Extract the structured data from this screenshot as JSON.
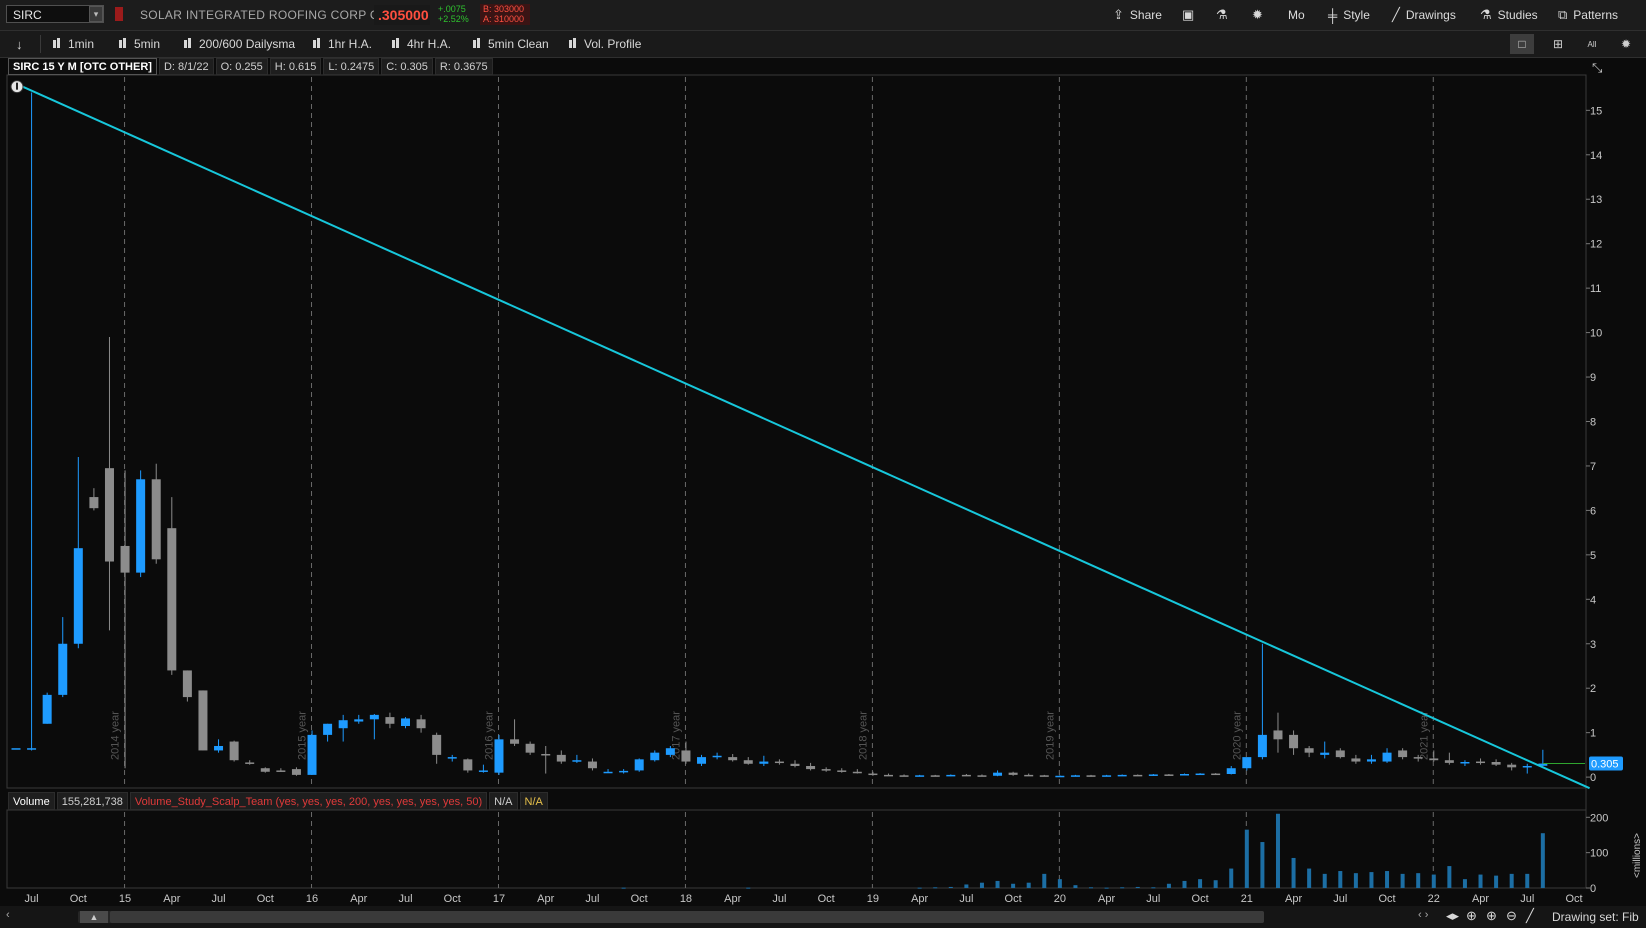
{
  "header": {
    "symbol": "SIRC",
    "dropdown_glyph": "▾",
    "company": "SOLAR INTEGRATED ROOFING CORP COM",
    "last_price": ".305000",
    "change_abs": "+.0075",
    "change_pct": "+2.52%",
    "bid": "B: 303000",
    "ask": "A: 310000",
    "buttons": {
      "share": "Share",
      "mo": "Mo",
      "style": "Style",
      "drawings": "Drawings",
      "studies": "Studies",
      "patterns": "Patterns"
    }
  },
  "toolbar": {
    "presets": [
      "1min",
      "5min",
      "200/600 Dailysma",
      "1hr H.A.",
      "4hr H.A.",
      "5min Clean",
      "Vol. Profile"
    ],
    "layout_all": "All"
  },
  "info_bar": {
    "title": "SIRC 15 Y M [OTC OTHER]",
    "date": "D: 8/1/22",
    "open": "O: 0.255",
    "high": "H: 0.615",
    "low": "L: 0.2475",
    "close": "C: 0.305",
    "range": "R: 0.3675"
  },
  "volume_bar": {
    "label": "Volume",
    "value": "155,281,738",
    "study": "Volume_Study_Scalp_Team (yes, yes, yes, 200, yes, yes, yes, yes, 50)",
    "na1": "N/A",
    "na2": "N/A"
  },
  "footer": {
    "drawing_set": "Drawing set: Fib"
  },
  "colors": {
    "up": "#1e9bff",
    "down": "#8c8c8c",
    "trendline": "#17c7db",
    "volume": "#1c6ea4",
    "price_label_bg": "#1e9bff",
    "grid": "#6a6a6a"
  },
  "chart_data": [
    {
      "type": "candlestick",
      "title": "SIRC 15 Y M [OTC OTHER]",
      "interval": "monthly",
      "ylim": [
        -0.2,
        15.75
      ],
      "y_ticks": [
        0,
        1,
        2,
        3,
        4,
        5,
        6,
        7,
        8,
        9,
        10,
        11,
        12,
        13,
        14,
        15
      ],
      "current_price_label": "0.305",
      "x_tick_labels": [
        "Jul",
        "Oct",
        "15",
        "Apr",
        "Jul",
        "Oct",
        "16",
        "Apr",
        "Jul",
        "Oct",
        "17",
        "Apr",
        "Jul",
        "Oct",
        "18",
        "Apr",
        "Jul",
        "Oct",
        "19",
        "Apr",
        "Jul",
        "Oct",
        "20",
        "Apr",
        "Jul",
        "Oct",
        "21",
        "Apr",
        "Jul",
        "Oct",
        "22",
        "Apr",
        "Jul",
        "Oct"
      ],
      "period_markers": [
        "2014 year",
        "2015 year",
        "2016 year",
        "2017 year",
        "2018 year",
        "2019 year",
        "2020 year",
        "2021 year"
      ],
      "candles": [
        {
          "d": "2014-06",
          "o": 0.65,
          "h": 0.65,
          "l": 0.65,
          "c": 0.65
        },
        {
          "d": "2014-07",
          "o": 0.65,
          "h": 15.4,
          "l": 0.6,
          "c": 0.65
        },
        {
          "d": "2014-08",
          "o": 1.2,
          "h": 1.9,
          "l": 1.2,
          "c": 1.85
        },
        {
          "d": "2014-09",
          "o": 1.85,
          "h": 3.6,
          "l": 1.8,
          "c": 3.0
        },
        {
          "d": "2014-10",
          "o": 3.0,
          "h": 7.2,
          "l": 2.9,
          "c": 5.15
        },
        {
          "d": "2014-11",
          "o": 6.3,
          "h": 6.5,
          "l": 6.0,
          "c": 6.05
        },
        {
          "d": "2014-12",
          "o": 6.95,
          "h": 9.9,
          "l": 3.3,
          "c": 4.85
        },
        {
          "d": "2015-01",
          "o": 5.2,
          "h": 6.9,
          "l": 0.2,
          "c": 4.6
        },
        {
          "d": "2015-02",
          "o": 4.6,
          "h": 6.9,
          "l": 4.5,
          "c": 6.7
        },
        {
          "d": "2015-03",
          "o": 6.7,
          "h": 7.05,
          "l": 4.8,
          "c": 4.9
        },
        {
          "d": "2015-04",
          "o": 5.6,
          "h": 6.3,
          "l": 2.3,
          "c": 2.4
        },
        {
          "d": "2015-05",
          "o": 2.4,
          "h": 2.4,
          "l": 1.7,
          "c": 1.8
        },
        {
          "d": "2015-06",
          "o": 1.95,
          "h": 1.95,
          "l": 0.6,
          "c": 0.6
        },
        {
          "d": "2015-07",
          "o": 0.6,
          "h": 0.85,
          "l": 0.55,
          "c": 0.7
        },
        {
          "d": "2015-08",
          "o": 0.8,
          "h": 0.82,
          "l": 0.35,
          "c": 0.38
        },
        {
          "d": "2015-09",
          "o": 0.33,
          "h": 0.38,
          "l": 0.28,
          "c": 0.3
        },
        {
          "d": "2015-10",
          "o": 0.2,
          "h": 0.22,
          "l": 0.1,
          "c": 0.12
        },
        {
          "d": "2015-11",
          "o": 0.15,
          "h": 0.2,
          "l": 0.12,
          "c": 0.14
        },
        {
          "d": "2015-12",
          "o": 0.18,
          "h": 0.22,
          "l": 0.03,
          "c": 0.05
        },
        {
          "d": "2016-01",
          "o": 0.05,
          "h": 1.05,
          "l": 0.05,
          "c": 0.95
        },
        {
          "d": "2016-02",
          "o": 0.95,
          "h": 1.2,
          "l": 0.8,
          "c": 1.2
        },
        {
          "d": "2016-03",
          "o": 1.1,
          "h": 1.4,
          "l": 0.8,
          "c": 1.28
        },
        {
          "d": "2016-04",
          "o": 1.25,
          "h": 1.4,
          "l": 1.2,
          "c": 1.3
        },
        {
          "d": "2016-05",
          "o": 1.3,
          "h": 1.42,
          "l": 0.85,
          "c": 1.4
        },
        {
          "d": "2016-06",
          "o": 1.35,
          "h": 1.45,
          "l": 1.1,
          "c": 1.2
        },
        {
          "d": "2016-07",
          "o": 1.15,
          "h": 1.35,
          "l": 1.1,
          "c": 1.32
        },
        {
          "d": "2016-08",
          "o": 1.3,
          "h": 1.4,
          "l": 1.0,
          "c": 1.1
        },
        {
          "d": "2016-09",
          "o": 0.95,
          "h": 1.0,
          "l": 0.3,
          "c": 0.5
        },
        {
          "d": "2016-10",
          "o": 0.45,
          "h": 0.5,
          "l": 0.35,
          "c": 0.45
        },
        {
          "d": "2016-11",
          "o": 0.4,
          "h": 0.42,
          "l": 0.1,
          "c": 0.15
        },
        {
          "d": "2016-12",
          "o": 0.15,
          "h": 0.28,
          "l": 0.1,
          "c": 0.15
        },
        {
          "d": "2017-01",
          "o": 0.1,
          "h": 0.95,
          "l": 0.05,
          "c": 0.85
        },
        {
          "d": "2017-02",
          "o": 0.85,
          "h": 1.3,
          "l": 0.7,
          "c": 0.75
        },
        {
          "d": "2017-03",
          "o": 0.75,
          "h": 0.8,
          "l": 0.5,
          "c": 0.55
        },
        {
          "d": "2017-04",
          "o": 0.52,
          "h": 0.7,
          "l": 0.08,
          "c": 0.5
        },
        {
          "d": "2017-05",
          "o": 0.5,
          "h": 0.6,
          "l": 0.3,
          "c": 0.35
        },
        {
          "d": "2017-06",
          "o": 0.35,
          "h": 0.5,
          "l": 0.32,
          "c": 0.38
        },
        {
          "d": "2017-07",
          "o": 0.35,
          "h": 0.42,
          "l": 0.15,
          "c": 0.2
        },
        {
          "d": "2017-08",
          "o": 0.12,
          "h": 0.18,
          "l": 0.1,
          "c": 0.12
        },
        {
          "d": "2017-09",
          "o": 0.12,
          "h": 0.18,
          "l": 0.08,
          "c": 0.14
        },
        {
          "d": "2017-10",
          "o": 0.15,
          "h": 0.42,
          "l": 0.12,
          "c": 0.4
        },
        {
          "d": "2017-11",
          "o": 0.38,
          "h": 0.6,
          "l": 0.35,
          "c": 0.55
        },
        {
          "d": "2017-12",
          "o": 0.5,
          "h": 0.7,
          "l": 0.45,
          "c": 0.65
        },
        {
          "d": "2018-01",
          "o": 0.6,
          "h": 0.8,
          "l": 0.3,
          "c": 0.35
        },
        {
          "d": "2018-02",
          "o": 0.3,
          "h": 0.5,
          "l": 0.25,
          "c": 0.45
        },
        {
          "d": "2018-03",
          "o": 0.45,
          "h": 0.55,
          "l": 0.4,
          "c": 0.48
        },
        {
          "d": "2018-04",
          "o": 0.45,
          "h": 0.52,
          "l": 0.35,
          "c": 0.38
        },
        {
          "d": "2018-05",
          "o": 0.38,
          "h": 0.45,
          "l": 0.28,
          "c": 0.3
        },
        {
          "d": "2018-06",
          "o": 0.3,
          "h": 0.48,
          "l": 0.25,
          "c": 0.35
        },
        {
          "d": "2018-07",
          "o": 0.35,
          "h": 0.4,
          "l": 0.28,
          "c": 0.32
        },
        {
          "d": "2018-08",
          "o": 0.3,
          "h": 0.38,
          "l": 0.22,
          "c": 0.25
        },
        {
          "d": "2018-09",
          "o": 0.25,
          "h": 0.32,
          "l": 0.15,
          "c": 0.18
        },
        {
          "d": "2018-10",
          "o": 0.18,
          "h": 0.22,
          "l": 0.12,
          "c": 0.15
        },
        {
          "d": "2018-11",
          "o": 0.15,
          "h": 0.2,
          "l": 0.1,
          "c": 0.12
        },
        {
          "d": "2018-12",
          "o": 0.12,
          "h": 0.18,
          "l": 0.08,
          "c": 0.1
        },
        {
          "d": "2019-01",
          "o": 0.08,
          "h": 0.12,
          "l": 0.03,
          "c": 0.05
        },
        {
          "d": "2019-02",
          "o": 0.05,
          "h": 0.08,
          "l": 0.03,
          "c": 0.04
        },
        {
          "d": "2019-03",
          "o": 0.04,
          "h": 0.06,
          "l": 0.02,
          "c": 0.03
        },
        {
          "d": "2019-04",
          "o": 0.03,
          "h": 0.05,
          "l": 0.02,
          "c": 0.04
        },
        {
          "d": "2019-05",
          "o": 0.04,
          "h": 0.05,
          "l": 0.02,
          "c": 0.03
        },
        {
          "d": "2019-06",
          "o": 0.03,
          "h": 0.06,
          "l": 0.02,
          "c": 0.05
        },
        {
          "d": "2019-07",
          "o": 0.05,
          "h": 0.07,
          "l": 0.03,
          "c": 0.04
        },
        {
          "d": "2019-08",
          "o": 0.04,
          "h": 0.06,
          "l": 0.02,
          "c": 0.03
        },
        {
          "d": "2019-09",
          "o": 0.03,
          "h": 0.15,
          "l": 0.02,
          "c": 0.1
        },
        {
          "d": "2019-10",
          "o": 0.1,
          "h": 0.12,
          "l": 0.03,
          "c": 0.05
        },
        {
          "d": "2019-11",
          "o": 0.05,
          "h": 0.08,
          "l": 0.03,
          "c": 0.04
        },
        {
          "d": "2019-12",
          "o": 0.04,
          "h": 0.05,
          "l": 0.02,
          "c": 0.03
        },
        {
          "d": "2020-01",
          "o": 0.02,
          "h": 0.04,
          "l": 0.01,
          "c": 0.03
        },
        {
          "d": "2020-02",
          "o": 0.03,
          "h": 0.05,
          "l": 0.02,
          "c": 0.04
        },
        {
          "d": "2020-03",
          "o": 0.04,
          "h": 0.05,
          "l": 0.01,
          "c": 0.02
        },
        {
          "d": "2020-04",
          "o": 0.02,
          "h": 0.05,
          "l": 0.02,
          "c": 0.04
        },
        {
          "d": "2020-05",
          "o": 0.04,
          "h": 0.06,
          "l": 0.03,
          "c": 0.05
        },
        {
          "d": "2020-06",
          "o": 0.05,
          "h": 0.06,
          "l": 0.03,
          "c": 0.04
        },
        {
          "d": "2020-07",
          "o": 0.04,
          "h": 0.07,
          "l": 0.03,
          "c": 0.06
        },
        {
          "d": "2020-08",
          "o": 0.06,
          "h": 0.07,
          "l": 0.04,
          "c": 0.05
        },
        {
          "d": "2020-09",
          "o": 0.05,
          "h": 0.08,
          "l": 0.04,
          "c": 0.07
        },
        {
          "d": "2020-10",
          "o": 0.07,
          "h": 0.09,
          "l": 0.05,
          "c": 0.08
        },
        {
          "d": "2020-11",
          "o": 0.08,
          "h": 0.09,
          "l": 0.06,
          "c": 0.07
        },
        {
          "d": "2020-12",
          "o": 0.07,
          "h": 0.25,
          "l": 0.06,
          "c": 0.2
        },
        {
          "d": "2021-01",
          "o": 0.2,
          "h": 0.35,
          "l": 0.15,
          "c": 0.45
        },
        {
          "d": "2021-02",
          "o": 0.45,
          "h": 3.0,
          "l": 0.4,
          "c": 0.95
        },
        {
          "d": "2021-03",
          "o": 1.05,
          "h": 1.45,
          "l": 0.55,
          "c": 0.85
        },
        {
          "d": "2021-04",
          "o": 0.95,
          "h": 1.05,
          "l": 0.5,
          "c": 0.65
        },
        {
          "d": "2021-05",
          "o": 0.65,
          "h": 0.7,
          "l": 0.45,
          "c": 0.55
        },
        {
          "d": "2021-06",
          "o": 0.5,
          "h": 0.8,
          "l": 0.42,
          "c": 0.55
        },
        {
          "d": "2021-07",
          "o": 0.6,
          "h": 0.65,
          "l": 0.42,
          "c": 0.45
        },
        {
          "d": "2021-08",
          "o": 0.42,
          "h": 0.5,
          "l": 0.3,
          "c": 0.35
        },
        {
          "d": "2021-09",
          "o": 0.35,
          "h": 0.5,
          "l": 0.3,
          "c": 0.4
        },
        {
          "d": "2021-10",
          "o": 0.35,
          "h": 0.65,
          "l": 0.32,
          "c": 0.55
        },
        {
          "d": "2021-11",
          "o": 0.6,
          "h": 0.65,
          "l": 0.4,
          "c": 0.45
        },
        {
          "d": "2021-12",
          "o": 0.45,
          "h": 0.5,
          "l": 0.35,
          "c": 0.42
        },
        {
          "d": "2022-01",
          "o": 0.42,
          "h": 0.6,
          "l": 0.35,
          "c": 0.38
        },
        {
          "d": "2022-02",
          "o": 0.38,
          "h": 0.55,
          "l": 0.28,
          "c": 0.32
        },
        {
          "d": "2022-03",
          "o": 0.32,
          "h": 0.38,
          "l": 0.25,
          "c": 0.34
        },
        {
          "d": "2022-04",
          "o": 0.35,
          "h": 0.42,
          "l": 0.28,
          "c": 0.33
        },
        {
          "d": "2022-05",
          "o": 0.34,
          "h": 0.4,
          "l": 0.25,
          "c": 0.28
        },
        {
          "d": "2022-06",
          "o": 0.28,
          "h": 0.32,
          "l": 0.15,
          "c": 0.22
        },
        {
          "d": "2022-07",
          "o": 0.22,
          "h": 0.3,
          "l": 0.08,
          "c": 0.25
        },
        {
          "d": "2022-08",
          "o": 0.255,
          "h": 0.615,
          "l": 0.2475,
          "c": 0.305
        }
      ],
      "trendline": [
        {
          "d": "2014-06",
          "value": 15.6
        },
        {
          "d": "2022-11",
          "value": -0.25
        }
      ],
      "current_price_line": 0.305
    },
    {
      "type": "bar",
      "title": "Volume",
      "unit": "<millions>",
      "ylim": [
        0,
        215
      ],
      "y_ticks": [
        0,
        100,
        200
      ],
      "values": [
        {
          "d": "2017-09",
          "v": 1
        },
        {
          "d": "2018-05",
          "v": 1
        },
        {
          "d": "2019-04",
          "v": 1
        },
        {
          "d": "2019-05",
          "v": 2
        },
        {
          "d": "2019-06",
          "v": 3
        },
        {
          "d": "2019-07",
          "v": 10
        },
        {
          "d": "2019-08",
          "v": 15
        },
        {
          "d": "2019-09",
          "v": 20
        },
        {
          "d": "2019-10",
          "v": 12
        },
        {
          "d": "2019-11",
          "v": 15
        },
        {
          "d": "2019-12",
          "v": 40
        },
        {
          "d": "2020-01",
          "v": 25
        },
        {
          "d": "2020-02",
          "v": 8
        },
        {
          "d": "2020-03",
          "v": 2
        },
        {
          "d": "2020-04",
          "v": 1
        },
        {
          "d": "2020-05",
          "v": 2
        },
        {
          "d": "2020-06",
          "v": 3
        },
        {
          "d": "2020-07",
          "v": 2
        },
        {
          "d": "2020-08",
          "v": 12
        },
        {
          "d": "2020-09",
          "v": 20
        },
        {
          "d": "2020-10",
          "v": 25
        },
        {
          "d": "2020-11",
          "v": 22
        },
        {
          "d": "2020-12",
          "v": 55
        },
        {
          "d": "2021-01",
          "v": 165
        },
        {
          "d": "2021-02",
          "v": 130
        },
        {
          "d": "2021-03",
          "v": 210
        },
        {
          "d": "2021-04",
          "v": 85
        },
        {
          "d": "2021-05",
          "v": 55
        },
        {
          "d": "2021-06",
          "v": 40
        },
        {
          "d": "2021-07",
          "v": 48
        },
        {
          "d": "2021-08",
          "v": 42
        },
        {
          "d": "2021-09",
          "v": 45
        },
        {
          "d": "2021-10",
          "v": 48
        },
        {
          "d": "2021-11",
          "v": 40
        },
        {
          "d": "2021-12",
          "v": 42
        },
        {
          "d": "2022-01",
          "v": 38
        },
        {
          "d": "2022-02",
          "v": 62
        },
        {
          "d": "2022-03",
          "v": 25
        },
        {
          "d": "2022-04",
          "v": 38
        },
        {
          "d": "2022-05",
          "v": 35
        },
        {
          "d": "2022-06",
          "v": 40
        },
        {
          "d": "2022-07",
          "v": 40
        },
        {
          "d": "2022-08",
          "v": 155
        }
      ]
    }
  ]
}
